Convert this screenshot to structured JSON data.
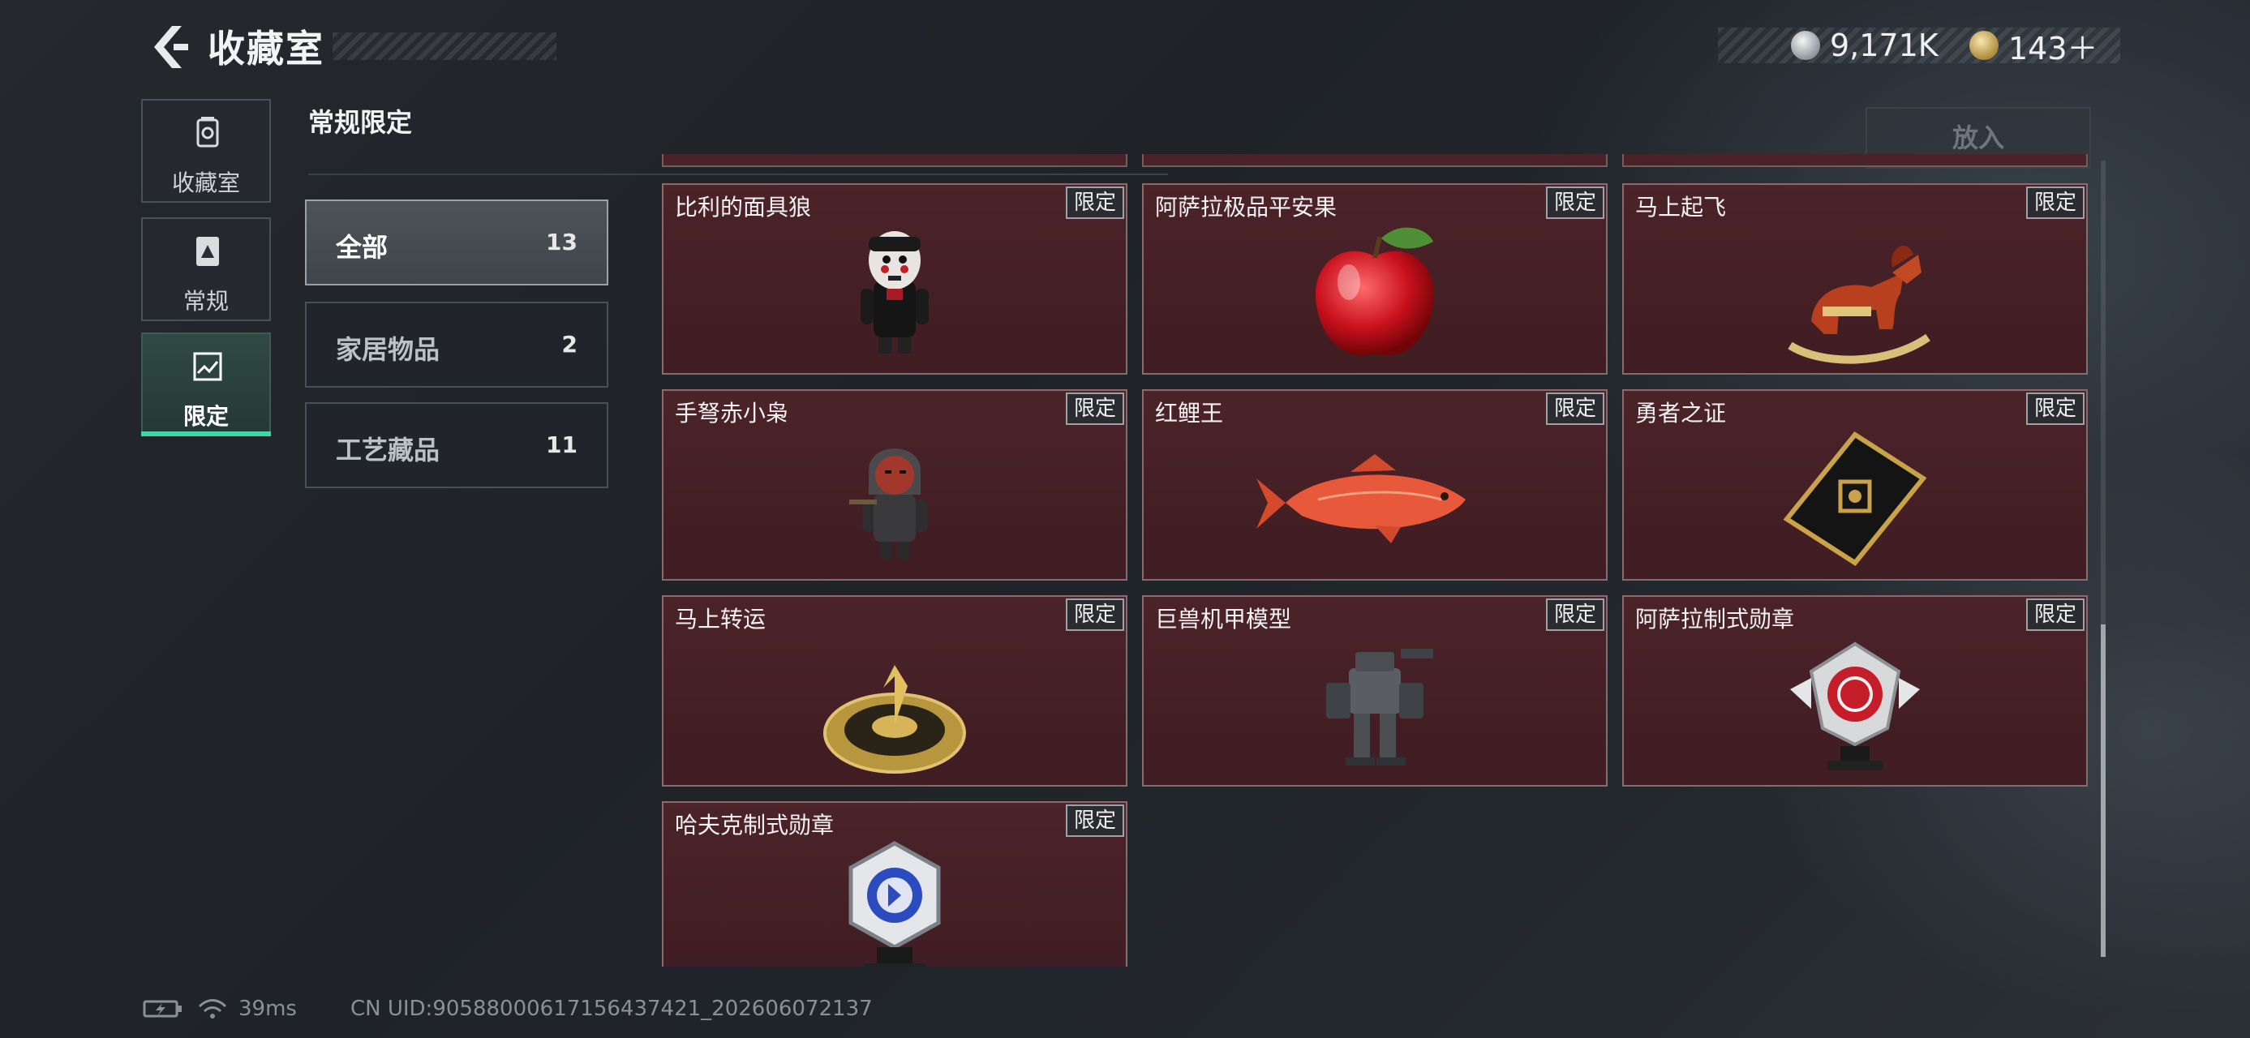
{
  "header": {
    "title": "收藏室",
    "currency": [
      {
        "icon": "silver-coin-icon",
        "value": "9,171K"
      },
      {
        "icon": "gold-coin-icon",
        "value": "143＋"
      }
    ]
  },
  "nav": [
    {
      "label": "收藏室",
      "icon": "vault-icon",
      "active": false
    },
    {
      "label": "常规",
      "icon": "document-icon",
      "active": false
    },
    {
      "label": "限定",
      "icon": "limited-frame-icon",
      "active": true
    }
  ],
  "section": {
    "title": "常规限定"
  },
  "categories": [
    {
      "name": "全部",
      "count": "13",
      "active": true
    },
    {
      "name": "家居物品",
      "count": "2",
      "active": false
    },
    {
      "name": "工艺藏品",
      "count": "11",
      "active": false
    }
  ],
  "put_in_label": "放入",
  "items": [
    {
      "name": "比利的面具狼",
      "badge": "限定",
      "art": "jigsaw-puppet-figure-icon"
    },
    {
      "name": "阿萨拉极品平安果",
      "badge": "限定",
      "art": "red-apple-icon"
    },
    {
      "name": "马上起飞",
      "badge": "限定",
      "art": "rocking-horse-icon"
    },
    {
      "name": "手弩赤小枭",
      "badge": "限定",
      "art": "hooded-crossbow-figure-icon"
    },
    {
      "name": "红鲤王",
      "badge": "限定",
      "art": "red-carp-fish-icon"
    },
    {
      "name": "勇者之证",
      "badge": "限定",
      "art": "black-gold-card-icon"
    },
    {
      "name": "马上转运",
      "badge": "限定",
      "art": "golden-horse-disc-icon"
    },
    {
      "name": "巨兽机甲模型",
      "badge": "限定",
      "art": "mech-robot-model-icon"
    },
    {
      "name": "阿萨拉制式勋章",
      "badge": "限定",
      "art": "winged-medal-icon"
    },
    {
      "name": "哈夫克制式勋章",
      "badge": "限定",
      "art": "hexagon-blue-medal-icon"
    }
  ],
  "footer": {
    "ping": "39ms",
    "uid": "CN UID:90588000617156437421_202606072137"
  },
  "colors": {
    "accent_green": "#3fd7a5",
    "card_bg": "#4b2329",
    "card_border": "#8a6b6d",
    "page_bg": "#22272d"
  }
}
